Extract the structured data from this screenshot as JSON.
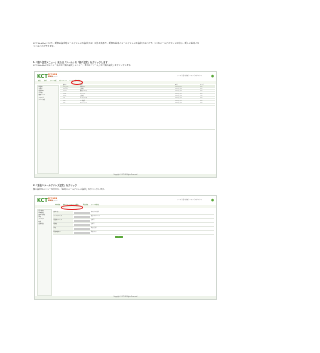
{
  "intro": {
    "line1": "KCT WebMail（以下、新規ID設定時メールアドレスを設定する）以外を含めて、新規の差出人メールアドレスを設定することで、1つのメールアカウントの中に、複数のメールアドレスを持つことができます。",
    "line1a": "KCT WebMail（以下、新規ID設定時メールアドレスを設定する）以外を含めて、新規の差出人メールアドレスを設定することで、1つのメールアカウントの中に、新しい差出人を",
    "line1b": "つくることができます。"
  },
  "step1": {
    "heading": "1.「個人設定メニュー」または「ツール」の「個人設定」をクリックします",
    "body": "KCT WebMail のメニュー右上の「個人設定」メニュー、または「ツール」の「個人設定」をクリックします。"
  },
  "step2": {
    "heading": "2.「差出人メールアドレス設定」をクリック",
    "body": "個人設定のメニューの中から、「差出人メールアドレス設定」をクリックします。"
  },
  "screen1": {
    "logo": "KCT",
    "logo_sub": "KCT WEB MAIL",
    "logo_sub2": "ケーブルテレビ",
    "top_links": "ツール | 個人設定 | ヘルプ | ログアウト",
    "menu": [
      "受信",
      "作成",
      "アドレス帳",
      "スケジュール",
      "ツール",
      "個人設定"
    ],
    "sidebar": [
      "受信箱",
      "下書き",
      "送信済み",
      "ゴミ箱",
      "迷惑メール",
      "フォルダ",
      "アドレス帳"
    ],
    "header": [
      "差出人",
      "件名",
      "日付",
      "サイズ"
    ],
    "rows": [
      [
        "info@kct",
        "お知らせ",
        "2013/05/01",
        "3KB"
      ],
      [
        "support",
        "ご案内",
        "2013/04/28",
        "5KB"
      ],
      [
        "admin",
        "設定について",
        "2013/04/25",
        "2KB"
      ],
      [
        "news",
        "ニュース",
        "2013/04/20",
        "8KB"
      ],
      [
        "office",
        "ご連絡",
        "2013/04/18",
        "4KB"
      ],
      [
        "kct",
        "メンテナンス",
        "2013/04/15",
        "6KB"
      ],
      [
        "user",
        "Re: 確認",
        "2013/04/10",
        "2KB"
      ],
      [
        "info",
        "キャンペーン",
        "2013/04/05",
        "9KB"
      ]
    ],
    "footer": "Copyright © KCT All Rights Reserved."
  },
  "screen2": {
    "logo": "KCT",
    "logo_sub": "KCT WEB MAIL",
    "logo_sub2": "ケーブルテレビ",
    "top_links": "ツール | 個人設定 | ヘルプ | ログアウト",
    "tabs": [
      "基本設定",
      "差出人メールアドレス設定",
      "署名設定",
      "フィルタ設定"
    ],
    "sidebar": [
      "個人設定",
      "基本設定",
      "差出人設定",
      "署名",
      "フィルタ",
      "転送",
      "自動返信"
    ],
    "form": [
      {
        "label": "差出人名",
        "value": "",
        "note": "表示される名前"
      },
      {
        "label": "メールアドレス",
        "value": "",
        "note": "差出人のアドレス"
      },
      {
        "label": "返信先アドレス",
        "value": "",
        "note": "省略可"
      },
      {
        "label": "組織名",
        "value": "",
        "note": "省略可"
      },
      {
        "label": "署名",
        "value": "",
        "note": "署名を選択"
      },
      {
        "label": "既定の差出人",
        "value": "",
        "note": "既定にする"
      }
    ],
    "save": "保存",
    "footer": "Copyright © KCT All Rights Reserved."
  },
  "colors": {
    "accent": "#5aa83a",
    "highlight": "#e01e1e"
  }
}
